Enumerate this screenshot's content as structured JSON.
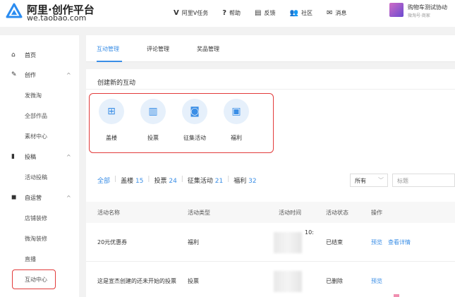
{
  "brand": {
    "title": "阿里·创作平台",
    "url": "we.taobao.com"
  },
  "nav": {
    "items": [
      {
        "label": "阿里V任务",
        "icon": "v-icon"
      },
      {
        "label": "帮助",
        "icon": "help-icon"
      },
      {
        "label": "反馈",
        "icon": "feedback-icon"
      },
      {
        "label": "社区",
        "icon": "community-icon"
      },
      {
        "label": "消息",
        "icon": "mail-icon"
      }
    ]
  },
  "user": {
    "name": "购物车测试协动",
    "sub": "微淘号·商家"
  },
  "sidebar": {
    "items": [
      {
        "label": "首页",
        "icon": "home-icon"
      },
      {
        "label": "创作",
        "icon": "pen-icon",
        "chevron": "^"
      },
      {
        "label": "发微淘"
      },
      {
        "label": "全部作品"
      },
      {
        "label": "素材中心"
      },
      {
        "label": "投稿",
        "icon": "doc-icon",
        "chevron": "^"
      },
      {
        "label": "活动投稿"
      },
      {
        "label": "自运营",
        "icon": "box-icon",
        "chevron": "^"
      },
      {
        "label": "店铺装修"
      },
      {
        "label": "微淘装修"
      },
      {
        "label": "直播"
      },
      {
        "label": "互动中心"
      }
    ]
  },
  "tabs": [
    "互动管理",
    "评论管理",
    "奖品管理"
  ],
  "create": {
    "title": "创建新的互动",
    "items": [
      {
        "label": "盖楼",
        "icon": "building-icon"
      },
      {
        "label": "投票",
        "icon": "bar-chart-icon"
      },
      {
        "label": "征集活动",
        "icon": "camera-icon"
      },
      {
        "label": "福利",
        "icon": "gift-icon"
      }
    ]
  },
  "filters": [
    {
      "label": "全部",
      "count": ""
    },
    {
      "label": "盖楼",
      "count": "15"
    },
    {
      "label": "投票",
      "count": "24"
    },
    {
      "label": "征集活动",
      "count": "21"
    },
    {
      "label": "福利",
      "count": "32"
    }
  ],
  "select": {
    "value": "所有"
  },
  "search": {
    "placeholder": "标题"
  },
  "table": {
    "headers": [
      "活动名称",
      "活动类型",
      "活动时间",
      "活动状态",
      "操作"
    ],
    "rows": [
      {
        "name": "20元优惠券",
        "type": "福利",
        "time_fragment": "10:",
        "status": "已结束",
        "actions": [
          "预览",
          "查看详情"
        ]
      },
      {
        "name": "这是宣杰创建的还未开始的投票",
        "type": "投票",
        "time_fragment": "",
        "status": "已删除",
        "actions": [
          "预览"
        ]
      }
    ]
  }
}
